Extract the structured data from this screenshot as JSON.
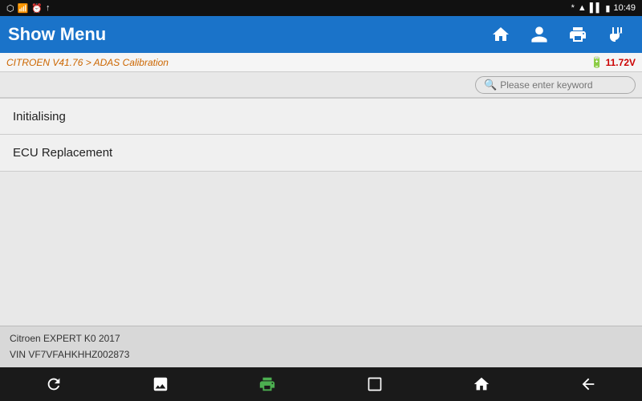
{
  "statusBar": {
    "time": "10:49",
    "leftIcons": [
      "wifi",
      "bluetooth",
      "battery"
    ]
  },
  "header": {
    "title": "Show Menu",
    "icons": {
      "home": "🏠",
      "person": "👤",
      "print": "🖨",
      "plug": "🔌"
    }
  },
  "breadcrumb": {
    "text": "CITROEN V41.76 > ADAS Calibration",
    "voltage": "11.72V"
  },
  "search": {
    "placeholder": "Please enter keyword"
  },
  "menuItems": [
    {
      "label": "Initialising"
    },
    {
      "label": "ECU Replacement"
    }
  ],
  "footer": {
    "line1": "Citroen EXPERT K0 2017",
    "line2": "VIN VF7VFAHKHHZ002873"
  },
  "navBar": {
    "refresh": "↺",
    "image": "🖼",
    "print": "🖨",
    "square": "□",
    "home": "⌂",
    "back": "↩"
  }
}
